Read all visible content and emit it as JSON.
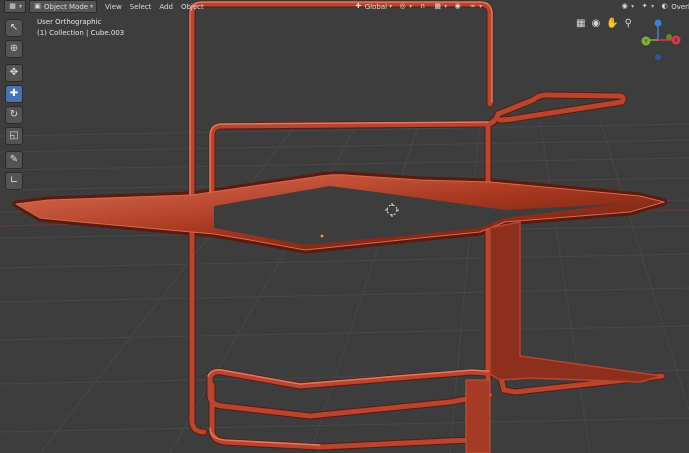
{
  "header": {
    "mode_label": "Object Mode",
    "menus": [
      "View",
      "Select",
      "Add",
      "Object"
    ],
    "orientation_label": "Global",
    "overlays_label": "Overlays"
  },
  "viewport": {
    "view_name": "User Orthographic",
    "collection_label": "(1) Collection | Cube.003"
  },
  "icons": {
    "editor_type": "cube-grid-icon",
    "transform": "axes-icon",
    "pivot": "pivot-icon",
    "snap": "magnet-icon",
    "snap_mode": "grid-snap-icon",
    "proportional": "proportional-edit-icon",
    "falloff": "falloff-curve-icon",
    "visibility": "eye-icon",
    "gizmos": "gizmo-icon",
    "overlays": "overlays-icon"
  },
  "gizmo": {
    "y_label": "Y",
    "x_label": "X"
  },
  "colors": {
    "viewport_bg": "#3d3d3d",
    "grid": "#484848",
    "object": "#b8452e",
    "active_tool": "#4772b3",
    "gizmo_x": "#d83a4a",
    "gizmo_y": "#7db33a",
    "gizmo_z": "#3e7fd6"
  }
}
